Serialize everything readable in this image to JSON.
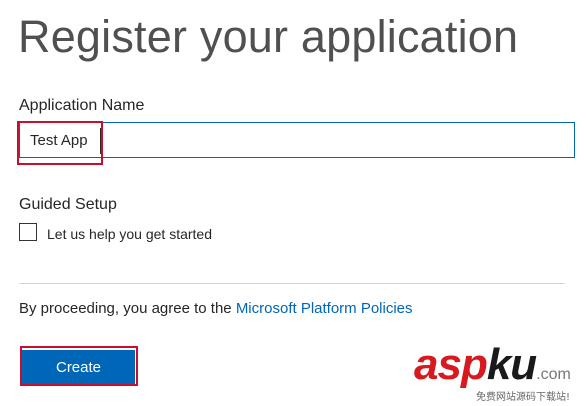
{
  "page": {
    "title": "Register your application"
  },
  "form": {
    "app_name_label": "Application Name",
    "app_name_value": "Test App",
    "guided_setup_label": "Guided Setup",
    "guided_setup_checkbox_label": "Let us help you get started",
    "guided_setup_checked": false,
    "consent_prefix": "By proceeding, you agree to the ",
    "consent_link": "Microsoft Platform Policies",
    "create_label": "Create"
  },
  "watermark": {
    "brand_asp": "asp",
    "brand_ku": "ku",
    "brand_tld": ".com",
    "tagline": "免费网站源码下载站!"
  },
  "colors": {
    "accent": "#0067b8",
    "annotation": "#c8102e"
  }
}
